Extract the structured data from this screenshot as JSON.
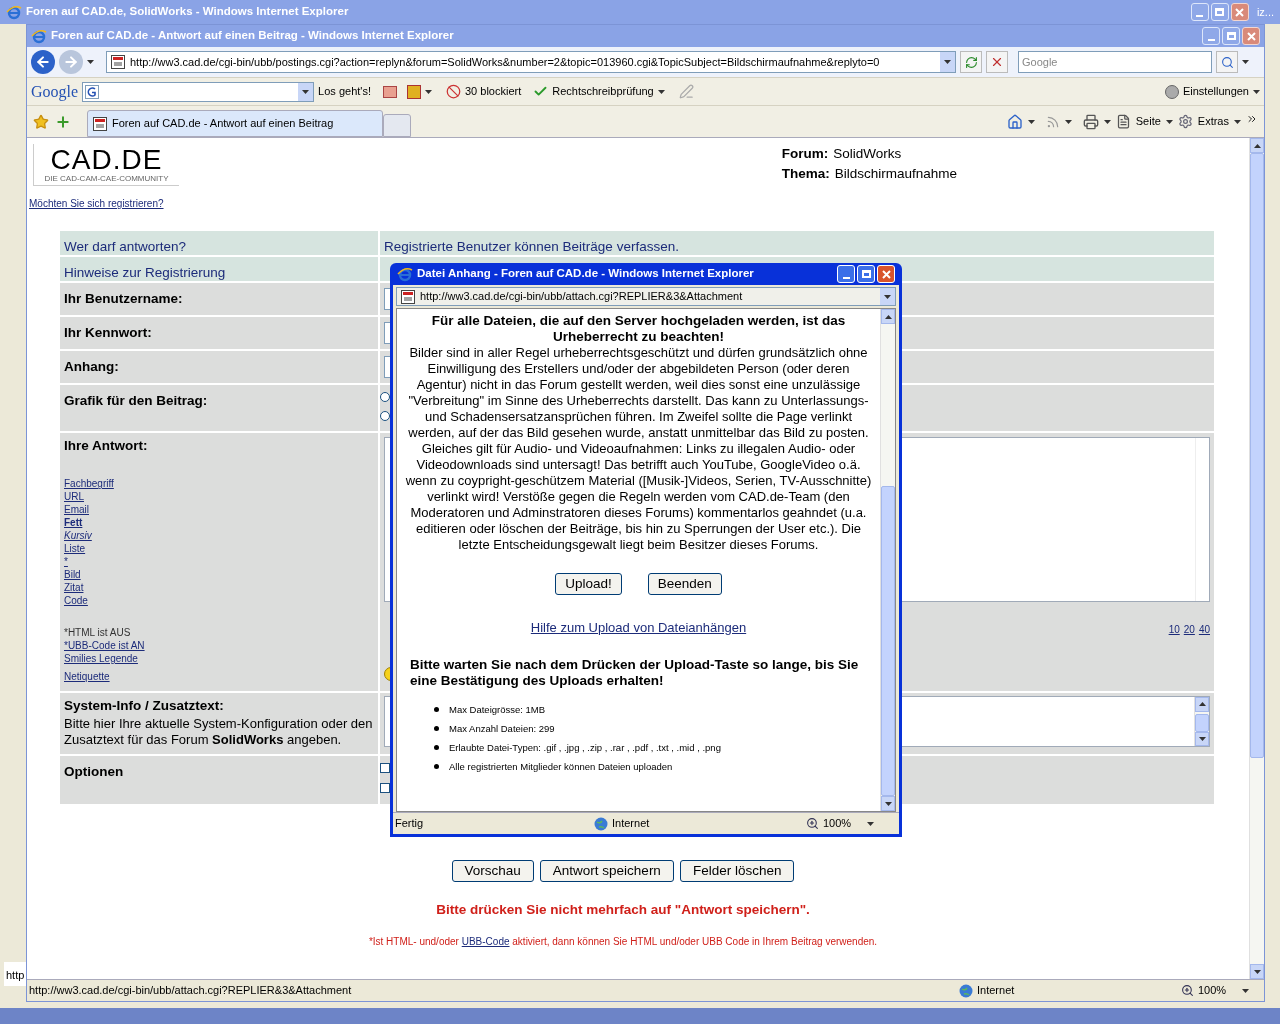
{
  "background_window": {
    "title": "Foren auf CAD.de, SolidWorks - Windows Internet Explorer",
    "edge_title": "iz...",
    "edge_status": "http"
  },
  "window": {
    "title": "Foren auf CAD.de - Antwort auf einen Beitrag - Windows Internet Explorer",
    "address": "http://ww3.cad.de/cgi-bin/ubb/postings.cgi?action=replyn&forum=SolidWorks&number=2&topic=013960.cgi&TopicSubject=Bildschirmaufnahme&replyto=0",
    "search_placeholder": "Google"
  },
  "google_toolbar": {
    "logo": "Google",
    "go_label": "Los geht's!",
    "blocked": "30 blockiert",
    "spellcheck": "Rechtschreibprüfung",
    "settings": "Einstellungen"
  },
  "tabs": [
    {
      "label": "Foren auf CAD.de - Antwort auf einen Beitrag",
      "selected": true
    }
  ],
  "command_bar": [
    "Seite",
    "Extras"
  ],
  "page": {
    "logo": "CAD.DE",
    "logo_tagline": "DIE CAD-CAM-CAE-COMMUNITY",
    "register_link": "Möchten Sie sich registrieren?",
    "info": [
      {
        "label": "Forum:",
        "value": "SolidWorks"
      },
      {
        "label": "Thema:",
        "value": "Bildschirmaufnahme"
      }
    ],
    "rows": [
      {
        "kind": "info",
        "label": "Wer darf antworten?",
        "value": "Registrierte Benutzer können Beiträge verfassen."
      },
      {
        "kind": "info",
        "label": "Hinweise zur Registrierung"
      },
      {
        "kind": "input",
        "label": "Ihr Benutzername:"
      },
      {
        "kind": "input",
        "label": "Ihr Kennwort:"
      },
      {
        "kind": "input",
        "label": "Anhang:"
      },
      {
        "kind": "radios",
        "label": "Grafik für den Beitrag:",
        "choices": [
          {
            "selected": false
          },
          {
            "selected": false
          }
        ]
      },
      {
        "kind": "message",
        "label": "Ihre Antwort:"
      },
      {
        "kind": "sysinfo",
        "label": "System-Info / Zusatztext:",
        "description": "Bitte hier Ihre aktuelle System-Konfiguration oder den Zusatztext für das Forum **SolidWorks** angeben."
      },
      {
        "kind": "options",
        "label": "Optionen",
        "boxes": [
          {
            "checked": false
          },
          {
            "checked": false
          }
        ]
      }
    ],
    "format_links": [
      {
        "label": "Fachbegriff",
        "kind": "plain"
      },
      {
        "label": "URL",
        "kind": "plain"
      },
      {
        "label": "Email",
        "kind": "plain"
      },
      {
        "label": "Fett",
        "kind": "bold"
      },
      {
        "label": "Kursiv",
        "kind": "italic"
      },
      {
        "label": "Liste",
        "kind": "plain"
      },
      {
        "label": "*",
        "kind": "plain"
      },
      {
        "label": "Bild",
        "kind": "plain"
      },
      {
        "label": "Zitat",
        "kind": "plain"
      },
      {
        "label": "Code",
        "kind": "plain"
      }
    ],
    "notes": [
      {
        "kind": "text",
        "label": "*HTML ist AUS"
      },
      {
        "kind": "link",
        "label": "*UBB-Code ist AN"
      },
      {
        "kind": "link",
        "label": "Smilies Legende"
      },
      {
        "kind": "gap"
      },
      {
        "kind": "link",
        "label": "Netiquette"
      }
    ],
    "size_links": [
      "10",
      "20",
      "40"
    ],
    "buttons": [
      "Vorschau",
      "Antwort speichern",
      "Felder löschen"
    ],
    "warning": "Bitte drücken Sie nicht mehrfach auf \"Antwort speichern\".",
    "footnote_before": "*Ist HTML- und/oder",
    "footnote_link": "UBB-Code",
    "footnote_after": "aktiviert, dann können Sie HTML und/oder UBB Code in Ihrem Beitrag verwenden."
  },
  "status_bar": {
    "url": "http://ww3.cad.de/cgi-bin/ubb/attach.cgi?REPLIER&3&Attachment",
    "zone": "Internet",
    "zoom": "100%"
  },
  "popup": {
    "title": "Datei Anhang - Foren auf CAD.de - Windows Internet Explorer",
    "address": "http://ww3.cad.de/cgi-bin/ubb/attach.cgi?REPLIER&3&Attachment",
    "heading": "Für alle Dateien, die auf den Server hochgeladen werden, ist das Urheberrecht zu beachten!",
    "paragraph": "Bilder sind in aller Regel urheberrechtsgeschützt und dürfen grundsätzlich ohne Einwilligung des Erstellers und/oder der abgebildeten Person (oder deren Agentur) nicht in das Forum gestellt werden, weil dies sonst eine unzulässige \"Verbreitung\" im Sinne des Urheberrechts darstellt. Das kann zu Unterlassungs- und Schadensersatzansprüchen führen. Im Zweifel sollte die Page verlinkt werden, auf der das Bild gesehen wurde, anstatt unmittelbar das Bild zu posten. Gleiches gilt für Audio- und Videoaufnahmen: Links zu illegalen Audio- oder Videodownloads sind untersagt! Das betrifft auch YouTube, GoogleVideo o.ä. wenn zu coypright-geschützem Material ([Musik-]Videos, Serien, TV-Ausschnitte) verlinkt wird! Verstöße gegen die Regeln werden vom CAD.de-Team (den Moderatoren und Adminstratoren dieses Forums) kommentarlos geahndet (u.a. editieren oder löschen der Beiträge, bis hin zu Sperrungen der User etc.). Die letzte Entscheidungsgewalt liegt beim Besitzer dieses Forums.",
    "buttons": [
      "Upload!",
      "Beenden"
    ],
    "help_link": "Hilfe zum Upload von Dateianhängen",
    "wait_note": "Bitte warten Sie nach dem Drücken der Upload-Taste so lange, bis Sie eine Bestätigung des Uploads erhalten!",
    "facts": [
      "Max Dateigrösse: 1MB",
      "Max Anzahl Dateien: 299",
      "Erlaubte Datei-Typen: .gif , .jpg , .zip , .rar , .pdf , .txt , .mid , .png",
      "Alle registrierten Mitglieder können Dateien uploaden"
    ],
    "status": {
      "text": "Fertig",
      "zone": "Internet",
      "zoom": "100%"
    }
  }
}
